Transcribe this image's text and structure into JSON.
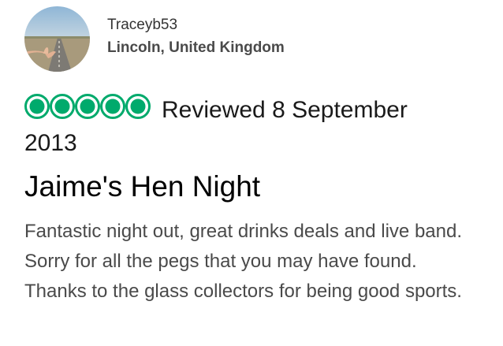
{
  "review": {
    "reviewer": {
      "username": "Traceyb53",
      "location": "Lincoln, United Kingdom",
      "avatar_icon": "avatar-photo-hitchhiker"
    },
    "rating": {
      "value": 5,
      "max": 5,
      "bubble_color": "#00aa6c",
      "bubble_icon": "rating-bubble-icon"
    },
    "reviewed_text": "Reviewed 8 September 2013",
    "title": "Jaime's Hen Night",
    "body": "Fantastic night out, great drinks deals and live band. Sorry for all the pegs that you may have found. Thanks to the glass collectors for being good sports."
  }
}
